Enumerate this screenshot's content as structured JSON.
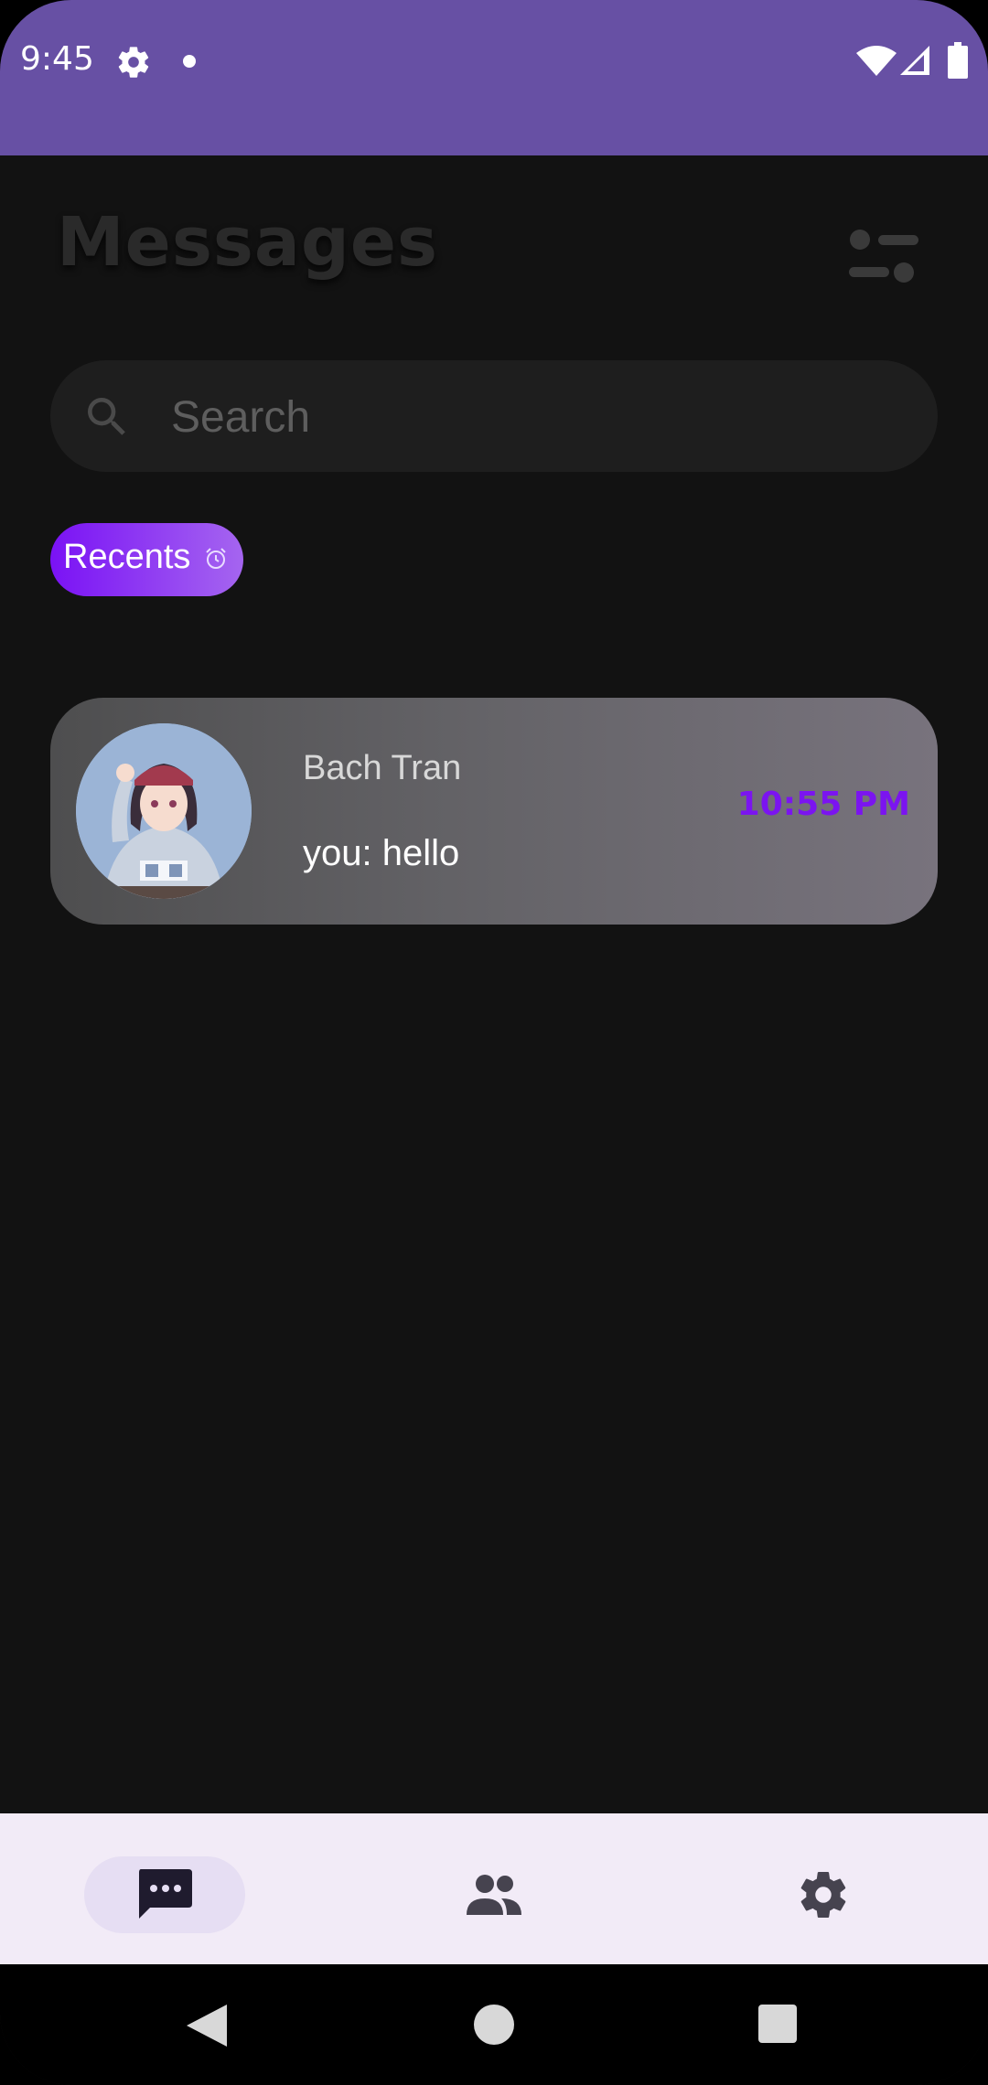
{
  "status_bar": {
    "time": "9:45",
    "icons": [
      "settings-icon",
      "notification-dot",
      "wifi-icon",
      "signal-icon",
      "battery-icon"
    ]
  },
  "header": {
    "title": "Messages",
    "filter_icon": "filter-icon"
  },
  "search": {
    "placeholder": "Search",
    "value": ""
  },
  "chips": [
    {
      "label": "Recents",
      "icon": "alarm-clock-icon"
    }
  ],
  "conversations": [
    {
      "name": "Bach Tran",
      "last_message": "you: hello",
      "time": "10:55 PM",
      "avatar": "anime-girl-avatar"
    }
  ],
  "bottom_nav": {
    "items": [
      {
        "id": "messages",
        "icon": "chat-bubble-icon",
        "active": true
      },
      {
        "id": "friends",
        "icon": "people-icon",
        "active": false
      },
      {
        "id": "settings",
        "icon": "settings-icon",
        "active": false
      }
    ]
  },
  "colors": {
    "status_bar": "#6750A4",
    "background": "#121212",
    "accent": "#7B14F0",
    "nav_background": "#F2EBF7"
  }
}
